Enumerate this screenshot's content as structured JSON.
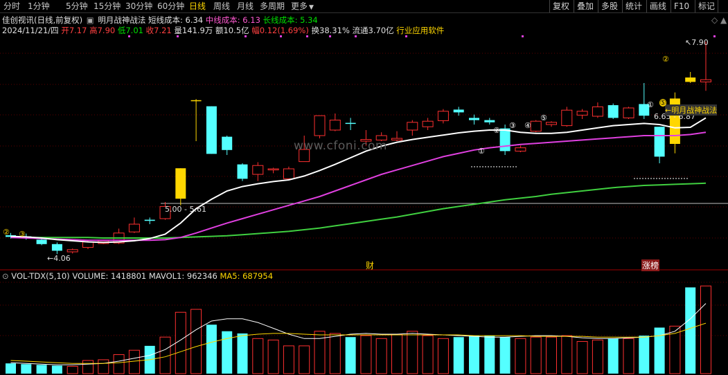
{
  "toolbar": {
    "periods": [
      "分时",
      "1分钟",
      "5分钟",
      "15分钟",
      "30分钟",
      "60分钟",
      "日线",
      "周线",
      "月线",
      "多周期",
      "更多"
    ],
    "active": "日线",
    "right_buttons": [
      "复权",
      "叠加",
      "多股",
      "统计",
      "画线",
      "F10",
      "标记"
    ]
  },
  "header": {
    "stock_title": "佳创视讯(日线,前复权)",
    "indicator_name": "明月战神战法",
    "short_cost_label": "短线成本: 6.34",
    "mid_cost_label": "中线成本: 6.13",
    "long_cost_label": "长线成本: 5.34"
  },
  "quote": {
    "date": "2024/11/21/四",
    "open_label": "开7.17",
    "high_label": "高7.90",
    "low_label": "低7.01",
    "close_label": "收7.21",
    "volume_label": "量141.9万",
    "amount_label": "额10.5亿",
    "change_label": "幅0.12(1.69%)",
    "turnover_label": "换38.31%",
    "float_label": "流通3.70亿",
    "industry": "行业应用软件"
  },
  "annotations": {
    "high_price": "7.90",
    "low_price": "4.06",
    "box1_label": "5.00 - 5.61",
    "box2_label": "6.65 - 6.87",
    "strategy_tag": "明月战神战法",
    "marker_cai": "财",
    "marker_zhangbang": "涨榜",
    "watermark": "www.cfoni.com",
    "circled": [
      "②",
      "③",
      "①",
      "②",
      "③",
      "④",
      "⑤",
      "①",
      "②",
      "⑤"
    ]
  },
  "volume_panel": {
    "title": "VOL-TDX(5,10)",
    "volume_label": "VOLUME: 1418801",
    "mavol1_label": "MAVOL1: 962346",
    "ma5_label": "MA5: 687954"
  },
  "colors": {
    "up": "#ff3030",
    "down": "#54ffff",
    "ma_short": "#ffffff",
    "ma_mid": "#e040e0",
    "ma_long": "#40d040",
    "highlight": "#ffd700"
  },
  "chart_data": {
    "type": "candlestick",
    "price_range": [
      3.8,
      8.0
    ],
    "candles": [
      {
        "o": 4.4,
        "h": 4.44,
        "l": 4.34,
        "c": 4.37
      },
      {
        "o": 4.38,
        "h": 4.43,
        "l": 4.32,
        "c": 4.35
      },
      {
        "o": 4.32,
        "h": 4.36,
        "l": 4.22,
        "c": 4.24
      },
      {
        "o": 4.24,
        "h": 4.27,
        "l": 4.06,
        "c": 4.12
      },
      {
        "o": 4.1,
        "h": 4.16,
        "l": 4.07,
        "c": 4.14
      },
      {
        "o": 4.18,
        "h": 4.3,
        "l": 4.15,
        "c": 4.28
      },
      {
        "o": 4.25,
        "h": 4.32,
        "l": 4.24,
        "c": 4.3
      },
      {
        "o": 4.26,
        "h": 4.52,
        "l": 4.24,
        "c": 4.44
      },
      {
        "o": 4.46,
        "h": 4.72,
        "l": 4.44,
        "c": 4.6
      },
      {
        "o": 4.68,
        "h": 4.72,
        "l": 4.6,
        "c": 4.66
      },
      {
        "o": 4.7,
        "h": 5.0,
        "l": 4.68,
        "c": 4.92
      },
      {
        "o": 5.06,
        "h": 5.61,
        "l": 4.94,
        "c": 5.61
      },
      {
        "o": 6.84,
        "h": 6.86,
        "l": 6.1,
        "c": 6.84
      },
      {
        "o": 6.73,
        "h": 6.73,
        "l": 5.87,
        "c": 5.87
      },
      {
        "o": 6.18,
        "h": 6.2,
        "l": 5.85,
        "c": 5.94
      },
      {
        "o": 5.68,
        "h": 5.7,
        "l": 5.38,
        "c": 5.42
      },
      {
        "o": 5.5,
        "h": 5.72,
        "l": 5.38,
        "c": 5.66
      },
      {
        "o": 5.58,
        "h": 5.62,
        "l": 5.52,
        "c": 5.6
      },
      {
        "o": 5.42,
        "h": 5.64,
        "l": 5.4,
        "c": 5.6
      },
      {
        "o": 5.73,
        "h": 6.2,
        "l": 5.73,
        "c": 5.95
      },
      {
        "o": 6.2,
        "h": 6.56,
        "l": 6.15,
        "c": 6.56
      },
      {
        "o": 6.3,
        "h": 6.6,
        "l": 6.28,
        "c": 6.48
      },
      {
        "o": 6.43,
        "h": 6.52,
        "l": 6.3,
        "c": 6.42
      },
      {
        "o": 6.1,
        "h": 6.3,
        "l": 6.02,
        "c": 6.13
      },
      {
        "o": 6.12,
        "h": 6.26,
        "l": 6.1,
        "c": 6.2
      },
      {
        "o": 6.12,
        "h": 6.28,
        "l": 6.1,
        "c": 6.15
      },
      {
        "o": 6.3,
        "h": 6.48,
        "l": 6.2,
        "c": 6.44
      },
      {
        "o": 6.36,
        "h": 6.52,
        "l": 6.3,
        "c": 6.46
      },
      {
        "o": 6.47,
        "h": 6.68,
        "l": 6.42,
        "c": 6.64
      },
      {
        "o": 6.67,
        "h": 6.72,
        "l": 6.56,
        "c": 6.62
      },
      {
        "o": 6.52,
        "h": 6.58,
        "l": 6.4,
        "c": 6.48
      },
      {
        "o": 6.48,
        "h": 6.52,
        "l": 6.4,
        "c": 6.44
      },
      {
        "o": 6.33,
        "h": 6.4,
        "l": 5.85,
        "c": 5.92
      },
      {
        "o": 5.92,
        "h": 6.02,
        "l": 5.9,
        "c": 5.98
      },
      {
        "o": 6.28,
        "h": 6.48,
        "l": 6.26,
        "c": 6.46
      },
      {
        "o": 6.4,
        "h": 6.46,
        "l": 6.36,
        "c": 6.44
      },
      {
        "o": 6.38,
        "h": 6.72,
        "l": 6.36,
        "c": 6.66
      },
      {
        "o": 6.57,
        "h": 6.68,
        "l": 6.5,
        "c": 6.64
      },
      {
        "o": 6.55,
        "h": 6.8,
        "l": 6.52,
        "c": 6.72
      },
      {
        "o": 6.75,
        "h": 6.78,
        "l": 6.5,
        "c": 6.52
      },
      {
        "o": 6.52,
        "h": 6.72,
        "l": 6.5,
        "c": 6.7
      },
      {
        "o": 6.77,
        "h": 7.15,
        "l": 6.5,
        "c": 6.56
      },
      {
        "o": 6.36,
        "h": 6.36,
        "l": 5.7,
        "c": 5.82
      },
      {
        "o": 6.05,
        "h": 6.98,
        "l": 5.88,
        "c": 6.87
      },
      {
        "o": 7.25,
        "h": 7.35,
        "l": 7.15,
        "c": 7.17
      },
      {
        "o": 7.17,
        "h": 7.9,
        "l": 7.01,
        "c": 7.21
      }
    ],
    "ma_short": [
      4.38,
      4.37,
      4.35,
      4.32,
      4.3,
      4.28,
      4.27,
      4.28,
      4.3,
      4.34,
      4.42,
      4.62,
      4.88,
      5.05,
      5.2,
      5.28,
      5.33,
      5.37,
      5.4,
      5.47,
      5.57,
      5.68,
      5.8,
      5.92,
      6.01,
      6.08,
      6.13,
      6.17,
      6.21,
      6.25,
      6.28,
      6.3,
      6.3,
      6.26,
      6.24,
      6.24,
      6.26,
      6.3,
      6.34,
      6.38,
      6.4,
      6.42,
      6.4,
      6.34,
      6.35,
      6.52
    ],
    "ma_mid": [
      4.36,
      4.35,
      4.34,
      4.33,
      4.32,
      4.31,
      4.31,
      4.31,
      4.31,
      4.31,
      4.32,
      4.36,
      4.44,
      4.53,
      4.62,
      4.7,
      4.78,
      4.86,
      4.94,
      5.02,
      5.1,
      5.2,
      5.3,
      5.4,
      5.5,
      5.58,
      5.66,
      5.74,
      5.82,
      5.88,
      5.94,
      5.98,
      6.01,
      6.04,
      6.06,
      6.08,
      6.1,
      6.12,
      6.14,
      6.16,
      6.18,
      6.2,
      6.2,
      6.2,
      6.22,
      6.26
    ],
    "ma_long": [
      4.36,
      4.36,
      4.36,
      4.36,
      4.36,
      4.36,
      4.35,
      4.35,
      4.35,
      4.35,
      4.35,
      4.36,
      4.37,
      4.38,
      4.39,
      4.41,
      4.43,
      4.45,
      4.47,
      4.5,
      4.53,
      4.57,
      4.61,
      4.65,
      4.69,
      4.73,
      4.78,
      4.83,
      4.88,
      4.92,
      4.96,
      5.0,
      5.04,
      5.07,
      5.1,
      5.14,
      5.17,
      5.2,
      5.23,
      5.26,
      5.28,
      5.3,
      5.31,
      5.32,
      5.33,
      5.34
    ],
    "volumes": [
      14,
      13,
      12,
      11,
      10,
      18,
      19,
      26,
      32,
      38,
      50,
      84,
      88,
      67,
      58,
      55,
      48,
      46,
      38,
      38,
      58,
      55,
      50,
      52,
      48,
      54,
      58,
      52,
      48,
      50,
      52,
      52,
      50,
      48,
      50,
      50,
      52,
      44,
      46,
      48,
      48,
      52,
      63,
      65,
      118,
      120
    ],
    "mavol1": [
      15,
      14,
      13,
      12,
      12,
      13,
      14,
      17,
      21,
      25,
      33,
      46,
      60,
      72,
      75,
      75,
      70,
      62,
      54,
      48,
      48,
      51,
      54,
      55,
      54,
      54,
      55,
      54,
      53,
      52,
      51,
      50,
      50,
      51,
      52,
      52,
      51,
      49,
      48,
      48,
      49,
      50,
      52,
      58,
      75,
      96
    ],
    "ma5": [
      18,
      17,
      16,
      15,
      14,
      14,
      14,
      15,
      17,
      19,
      23,
      30,
      37,
      43,
      48,
      52,
      54,
      55,
      55,
      54,
      53,
      53,
      53,
      53,
      53,
      53,
      53,
      53,
      53,
      53,
      52,
      52,
      52,
      52,
      51,
      51,
      51,
      51,
      50,
      50,
      50,
      50,
      52,
      55,
      62,
      69
    ]
  }
}
